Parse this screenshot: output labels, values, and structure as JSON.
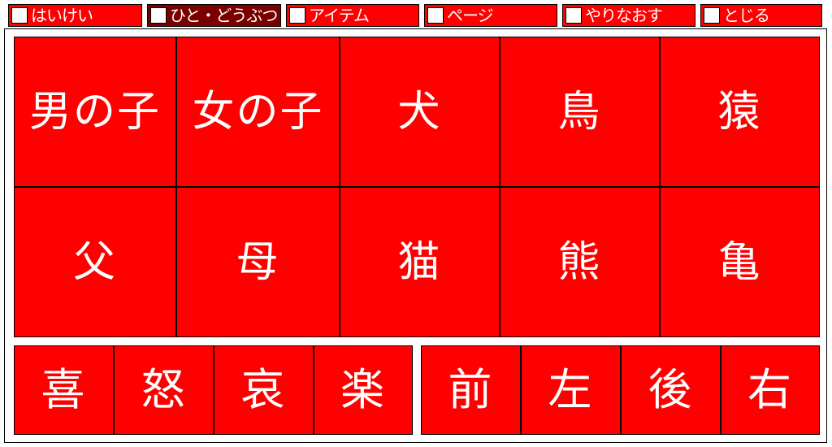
{
  "tabs": [
    {
      "label": "はいけい",
      "active": false
    },
    {
      "label": "ひと・どうぶつ",
      "active": true
    },
    {
      "label": "アイテム",
      "active": false
    },
    {
      "label": "ページ",
      "active": false
    },
    {
      "label": "やりなおす",
      "active": false
    },
    {
      "label": "とじる",
      "active": false
    }
  ],
  "characters": {
    "row1": [
      {
        "label": "男の子"
      },
      {
        "label": "女の子"
      },
      {
        "label": "犬"
      },
      {
        "label": "鳥"
      },
      {
        "label": "猿"
      }
    ],
    "row2": [
      {
        "label": "父"
      },
      {
        "label": "母"
      },
      {
        "label": "猫"
      },
      {
        "label": "熊"
      },
      {
        "label": "亀"
      }
    ]
  },
  "emotions": [
    {
      "label": "喜"
    },
    {
      "label": "怒"
    },
    {
      "label": "哀"
    },
    {
      "label": "楽"
    }
  ],
  "directions": [
    {
      "label": "前"
    },
    {
      "label": "左"
    },
    {
      "label": "後"
    },
    {
      "label": "右"
    }
  ],
  "colors": {
    "cell_background": "#ff0000",
    "active_tab_background": "#7a0000",
    "text": "#ffffff",
    "border": "#000000"
  }
}
